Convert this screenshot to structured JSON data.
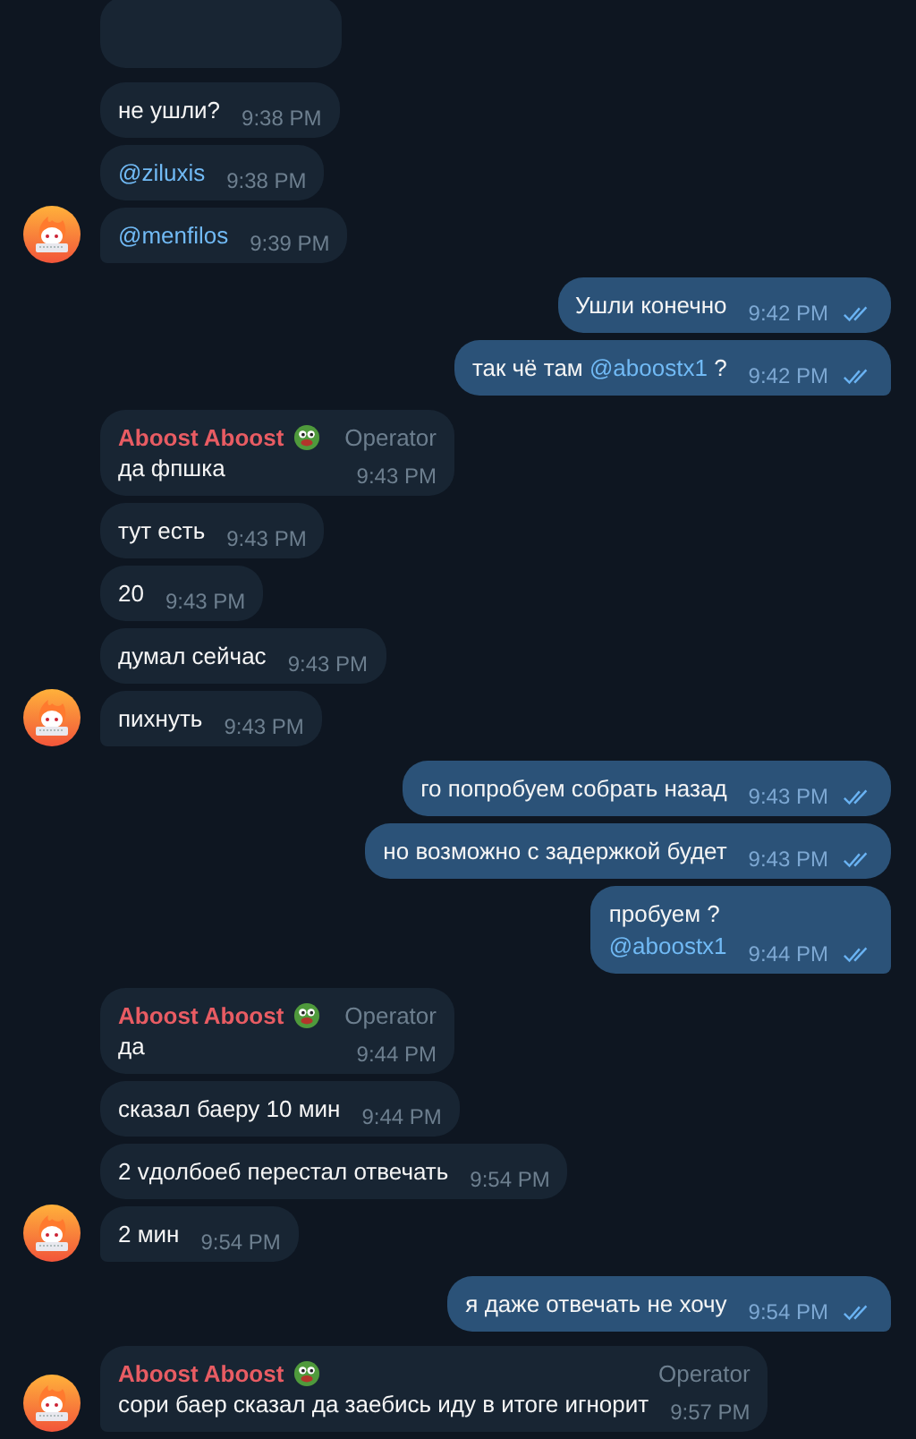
{
  "groups": [
    {
      "kind": "incoming",
      "messages": [
        {
          "parts": [
            {
              "kind": "text",
              "text": "не ушли?"
            }
          ],
          "time": "9:38 PM"
        },
        {
          "parts": [
            {
              "kind": "mention",
              "text": "@ziluxis"
            }
          ],
          "time": "9:38 PM"
        },
        {
          "parts": [
            {
              "kind": "mention",
              "text": "@menfilos"
            }
          ],
          "time": "9:39 PM"
        }
      ]
    },
    {
      "kind": "outgoing",
      "messages": [
        {
          "parts": [
            {
              "kind": "text",
              "text": "Ушли конечно"
            }
          ],
          "time": "9:42 PM",
          "read": true
        },
        {
          "parts": [
            {
              "kind": "text",
              "text": "так чё там "
            },
            {
              "kind": "mention",
              "text": "@aboostx1"
            },
            {
              "kind": "text",
              "text": " ?"
            }
          ],
          "time": "9:42 PM",
          "read": true
        }
      ]
    },
    {
      "kind": "incoming",
      "messages": [
        {
          "sender": {
            "name": "Aboost Aboost",
            "role": "Operator"
          },
          "parts": [
            {
              "kind": "text",
              "text": "да фпшка"
            }
          ],
          "time": "9:43 PM"
        },
        {
          "parts": [
            {
              "kind": "text",
              "text": "тут есть"
            }
          ],
          "time": "9:43 PM"
        },
        {
          "parts": [
            {
              "kind": "text",
              "text": "20"
            }
          ],
          "time": "9:43 PM"
        },
        {
          "parts": [
            {
              "kind": "text",
              "text": "думал сейчас"
            }
          ],
          "time": "9:43 PM"
        },
        {
          "parts": [
            {
              "kind": "text",
              "text": "пихнуть"
            }
          ],
          "time": "9:43 PM"
        }
      ]
    },
    {
      "kind": "outgoing",
      "messages": [
        {
          "parts": [
            {
              "kind": "text",
              "text": "го попробуем собрать назад"
            }
          ],
          "time": "9:43 PM",
          "read": true
        },
        {
          "parts": [
            {
              "kind": "text",
              "text": "но возможно с задержкой будет"
            }
          ],
          "time": "9:43 PM",
          "read": true
        },
        {
          "parts": [
            {
              "kind": "text",
              "text": "пробуем ?"
            },
            {
              "kind": "break"
            },
            {
              "kind": "mention",
              "text": "@aboostx1"
            }
          ],
          "time": "9:44 PM",
          "read": true
        }
      ]
    },
    {
      "kind": "incoming",
      "messages": [
        {
          "sender": {
            "name": "Aboost Aboost",
            "role": "Operator"
          },
          "parts": [
            {
              "kind": "text",
              "text": "да"
            }
          ],
          "time": "9:44 PM"
        },
        {
          "parts": [
            {
              "kind": "text",
              "text": "сказал баеру 10 мин"
            }
          ],
          "time": "9:44 PM"
        },
        {
          "parts": [
            {
              "kind": "text",
              "text": "2 vдолбоеб перестал отвечать"
            }
          ],
          "time": "9:54 PM"
        },
        {
          "parts": [
            {
              "kind": "text",
              "text": "2 мин"
            }
          ],
          "time": "9:54 PM"
        }
      ]
    },
    {
      "kind": "outgoing",
      "messages": [
        {
          "parts": [
            {
              "kind": "text",
              "text": "я даже отвечать не хочу"
            }
          ],
          "time": "9:54 PM",
          "read": true
        }
      ]
    },
    {
      "kind": "incoming",
      "messages": [
        {
          "sender": {
            "name": "Aboost Aboost",
            "role": "Operator"
          },
          "parts": [
            {
              "kind": "text",
              "text": "сори баер сказал да заебись иду в итоге игнорит"
            }
          ],
          "time": "9:57 PM"
        }
      ]
    }
  ]
}
